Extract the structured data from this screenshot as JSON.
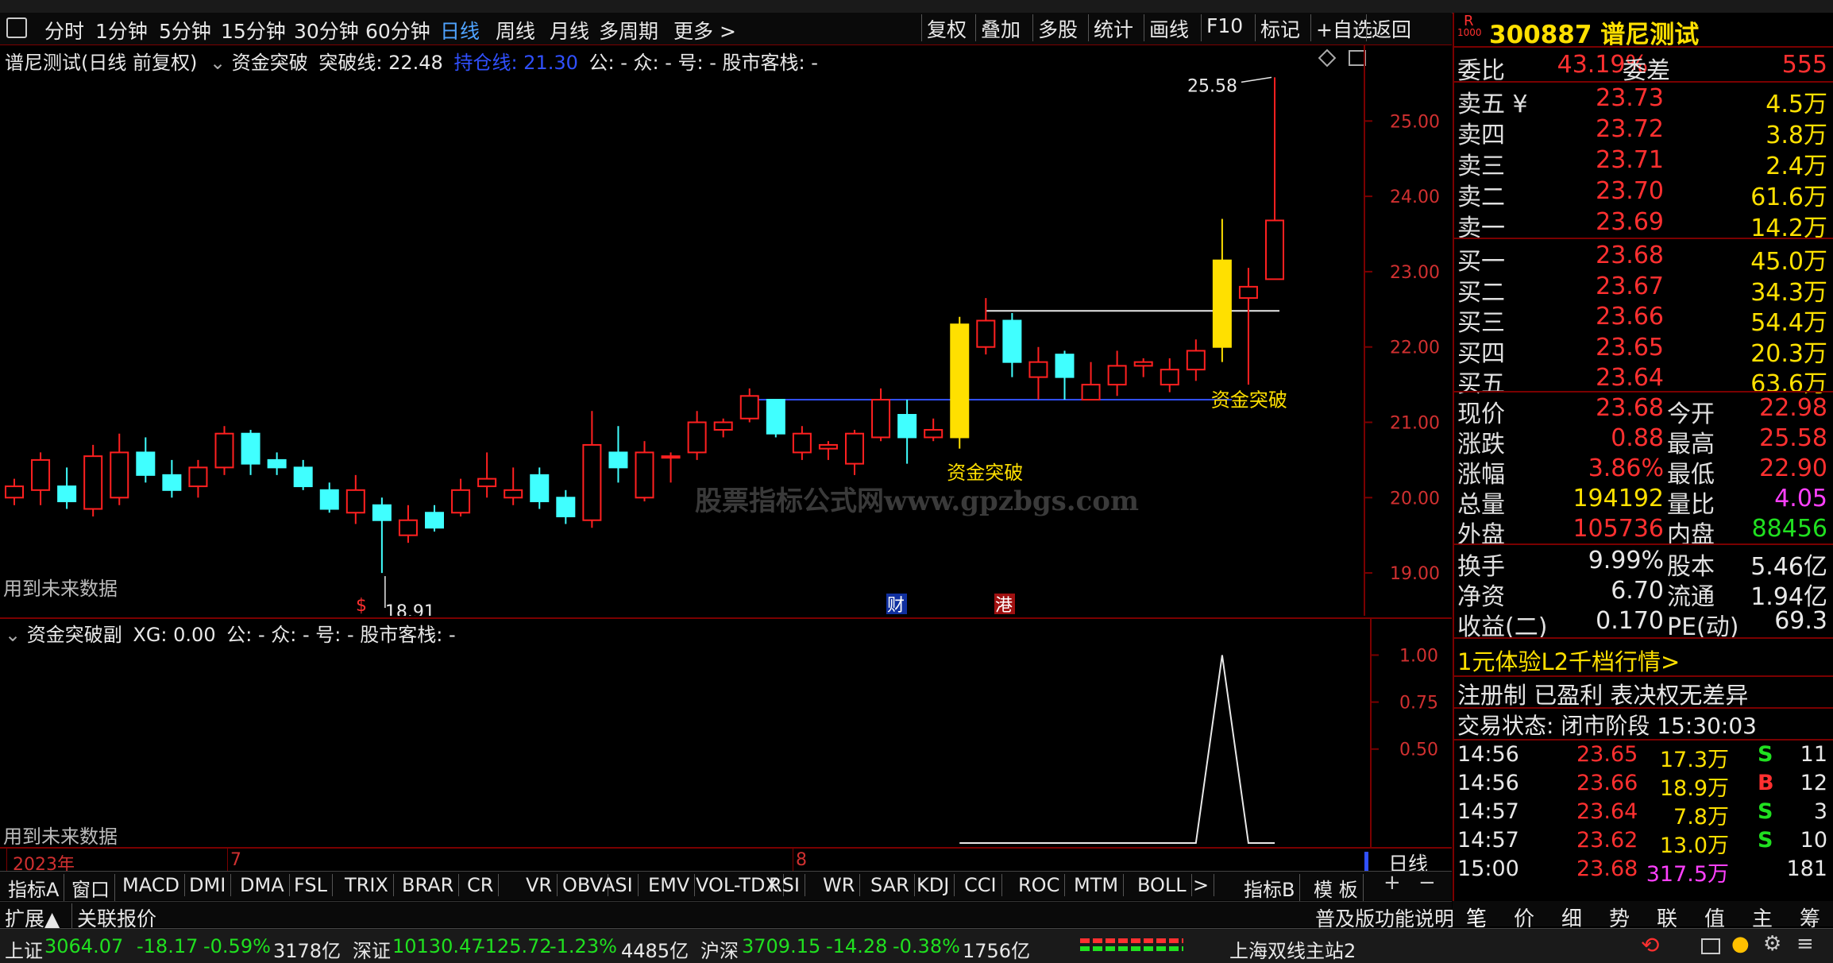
{
  "periods": [
    "分时",
    "1分钟",
    "5分钟",
    "15分钟",
    "30分钟",
    "60分钟",
    "日线",
    "周线",
    "月线",
    "多周期",
    "更多 >"
  ],
  "selected_period": "日线",
  "tools": [
    "复权",
    "叠加",
    "多股",
    "统计",
    "画线",
    "F10",
    "标记",
    "+自选",
    "返回"
  ],
  "main_header": {
    "title": "谱尼测试(日线 前复权)",
    "indicator": "资金突破",
    "line1": "突破线: 22.48",
    "line2": "持仓线: 21.30",
    "rest": "公: -  众: -  号: -  股市客栈: -"
  },
  "sub_header": {
    "indicator": "资金突破副",
    "xg": "XG: 0.00",
    "rest": "公: -  众: -  号: -  股市客栈: -"
  },
  "future_note": "用到未来数据",
  "watermark": "股票指标公式网www.gpzbgs.com",
  "annotations": {
    "high": "25.58",
    "low": "18.91",
    "signal1": "资金突破",
    "signal2": "资金突破",
    "mark_s": "$",
    "mark_cai": "财",
    "mark_gang": "港"
  },
  "axis_dates": {
    "year": "2023年",
    "m7": "7",
    "m8": "8"
  },
  "period_label": "日线",
  "zoom": {
    "plus": "+",
    "minus": "−"
  },
  "chart_data": {
    "type": "candlestick",
    "ylim": [
      18.6,
      25.9
    ],
    "yticks": [
      "25.00",
      "24.00",
      "23.00",
      "22.00",
      "21.00",
      "20.00",
      "19.00"
    ],
    "candles": [
      [
        20.0,
        20.15,
        19.9,
        20.25
      ],
      [
        20.1,
        20.5,
        19.9,
        20.6
      ],
      [
        20.15,
        19.95,
        19.85,
        20.4
      ],
      [
        19.85,
        20.55,
        19.75,
        20.7
      ],
      [
        20.0,
        20.6,
        19.9,
        20.85
      ],
      [
        20.6,
        20.3,
        20.2,
        20.8
      ],
      [
        20.3,
        20.1,
        20.0,
        20.5
      ],
      [
        20.15,
        20.4,
        20.0,
        20.5
      ],
      [
        20.4,
        20.85,
        20.3,
        20.95
      ],
      [
        20.85,
        20.45,
        20.3,
        20.9
      ],
      [
        20.5,
        20.4,
        20.3,
        20.6
      ],
      [
        20.4,
        20.15,
        20.1,
        20.5
      ],
      [
        20.1,
        19.85,
        19.8,
        20.2
      ],
      [
        19.8,
        20.1,
        19.65,
        20.3
      ],
      [
        19.9,
        19.7,
        19.0,
        20.0
      ],
      [
        19.5,
        19.7,
        19.4,
        19.9
      ],
      [
        19.8,
        19.6,
        19.55,
        19.9
      ],
      [
        19.8,
        20.1,
        19.75,
        20.25
      ],
      [
        20.15,
        20.25,
        20.0,
        20.6
      ],
      [
        20.0,
        20.1,
        19.9,
        20.4
      ],
      [
        20.3,
        19.95,
        19.85,
        20.4
      ],
      [
        20.0,
        19.75,
        19.65,
        20.1
      ],
      [
        19.7,
        20.7,
        19.6,
        21.15
      ],
      [
        20.6,
        20.4,
        20.2,
        20.95
      ],
      [
        20.0,
        20.6,
        19.95,
        20.75
      ],
      [
        20.55,
        20.55,
        20.2,
        20.6
      ],
      [
        20.6,
        21.0,
        20.5,
        21.15
      ],
      [
        20.9,
        21.0,
        20.8,
        21.05
      ],
      [
        21.05,
        21.35,
        21.0,
        21.45
      ],
      [
        21.3,
        20.85,
        20.8,
        21.3
      ],
      [
        20.6,
        20.85,
        20.5,
        20.95
      ],
      [
        20.65,
        20.7,
        20.5,
        20.75
      ],
      [
        20.45,
        20.85,
        20.3,
        20.9
      ],
      [
        20.8,
        21.3,
        20.75,
        21.45
      ],
      [
        21.1,
        20.8,
        20.45,
        21.3
      ],
      [
        20.8,
        20.9,
        20.75,
        21.05
      ],
      [
        20.8,
        22.3,
        20.65,
        22.4
      ],
      [
        22.0,
        22.35,
        21.9,
        22.65
      ],
      [
        22.35,
        21.8,
        21.6,
        22.45
      ],
      [
        21.6,
        21.8,
        21.3,
        22.0
      ],
      [
        21.9,
        21.6,
        21.3,
        21.95
      ],
      [
        21.3,
        21.5,
        21.3,
        21.8
      ],
      [
        21.5,
        21.75,
        21.35,
        21.95
      ],
      [
        21.75,
        21.8,
        21.6,
        21.85
      ],
      [
        21.5,
        21.7,
        21.4,
        21.85
      ],
      [
        21.7,
        21.95,
        21.55,
        22.1
      ],
      [
        22.0,
        23.15,
        21.8,
        23.7
      ],
      [
        22.65,
        22.8,
        21.5,
        23.05
      ],
      [
        22.9,
        23.68,
        22.9,
        25.58
      ]
    ],
    "breakout_line": 22.48,
    "hold_line": 21.3,
    "sub_ylim": [
      0,
      1.15
    ],
    "sub_yticks": [
      "1.00",
      "0.75",
      "0.50"
    ],
    "sub_values": [
      0,
      0,
      0,
      0,
      0,
      0,
      0,
      0,
      0,
      0,
      0,
      0,
      0,
      0,
      0,
      0,
      0,
      0,
      0,
      0,
      0,
      0,
      0,
      0,
      0,
      0,
      0,
      0,
      0,
      0,
      0,
      0,
      0,
      0,
      0,
      0,
      0,
      0,
      0,
      0,
      0,
      0,
      0,
      0,
      0,
      0,
      1,
      0,
      0
    ]
  },
  "quote": {
    "code": "300887",
    "name": "谱尼测试",
    "rflag": "R",
    "rsub": "1000",
    "weibi_lbl": "委比",
    "weibi": "43.19%",
    "weicha_lbl": "委差",
    "weicha": "555",
    "sells": [
      {
        "l": "卖五 ¥",
        "p": "23.73",
        "v": "4.5万"
      },
      {
        "l": "卖四",
        "p": "23.72",
        "v": "3.8万"
      },
      {
        "l": "卖三",
        "p": "23.71",
        "v": "2.4万"
      },
      {
        "l": "卖二",
        "p": "23.70",
        "v": "61.6万"
      },
      {
        "l": "卖一",
        "p": "23.69",
        "v": "14.2万"
      }
    ],
    "buys": [
      {
        "l": "买一",
        "p": "23.68",
        "v": "45.0万"
      },
      {
        "l": "买二",
        "p": "23.67",
        "v": "34.3万"
      },
      {
        "l": "买三",
        "p": "23.66",
        "v": "54.4万"
      },
      {
        "l": "买四",
        "p": "23.65",
        "v": "20.3万"
      },
      {
        "l": "买五",
        "p": "23.64",
        "v": "63.6万"
      }
    ],
    "stats": [
      {
        "l1": "现价",
        "v1": "23.68",
        "c1": "red",
        "l2": "今开",
        "v2": "22.98",
        "c2": "red"
      },
      {
        "l1": "涨跌",
        "v1": "0.88",
        "c1": "red",
        "l2": "最高",
        "v2": "25.58",
        "c2": "red"
      },
      {
        "l1": "涨幅",
        "v1": "3.86%",
        "c1": "red",
        "l2": "最低",
        "v2": "22.90",
        "c2": "red"
      },
      {
        "l1": "总量",
        "v1": "194192",
        "c1": "yel",
        "l2": "量比",
        "v2": "4.05",
        "c2": "mag"
      },
      {
        "l1": "外盘",
        "v1": "105736",
        "c1": "red",
        "l2": "内盘",
        "v2": "88456",
        "c2": "green"
      }
    ],
    "stats2": [
      {
        "l1": "换手",
        "v1": "9.99%",
        "l2": "股本",
        "v2": "5.46亿"
      },
      {
        "l1": "净资",
        "v1": "6.70",
        "l2": "流通",
        "v2": "1.94亿"
      },
      {
        "l1": "收益(二)",
        "v1": "0.170",
        "l2": "PE(动)",
        "v2": "69.3"
      }
    ],
    "promo": "1元体验L2千档行情>",
    "notice": "注册制 已盈利 表决权无差异",
    "trade_status": "交易状态: 闭市阶段 15:30:03",
    "ticks": [
      {
        "t": "14:56",
        "p": "23.65",
        "v": "17.3万",
        "s": "S",
        "n": "11"
      },
      {
        "t": "14:56",
        "p": "23.66",
        "v": "18.9万",
        "s": "B",
        "n": "12"
      },
      {
        "t": "14:57",
        "p": "23.64",
        "v": "7.8万",
        "s": "S",
        "n": "3"
      },
      {
        "t": "14:57",
        "p": "23.62",
        "v": "13.0万",
        "s": "S",
        "n": "10"
      },
      {
        "t": "15:00",
        "p": "23.68",
        "v": "317.5万",
        "s": "",
        "n": "181"
      }
    ]
  },
  "indicators": [
    "指标A",
    "窗口",
    "MACD",
    "DMI",
    "DMA",
    "FSL",
    "TRIX",
    "BRAR",
    "CR",
    "VR",
    "OBV",
    "ASI",
    "EMV",
    "VOL-TDX",
    "RSI",
    "WR",
    "SAR",
    "KDJ",
    "CCI",
    "ROC",
    "MTM",
    "BOLL",
    ">"
  ],
  "ind_right": [
    "指标B",
    "模 板"
  ],
  "ext": [
    "扩展▲",
    "关联报价"
  ],
  "ext_right": "普及版功能说明",
  "qtabs": [
    "笔",
    "价",
    "细",
    "势",
    "联",
    "值",
    "主",
    "筹"
  ],
  "status": {
    "sh_lbl": "上证",
    "sh": "3064.07",
    "sh_chg": "-18.17",
    "sh_pct": "-0.59%",
    "sh_amt": "3178亿",
    "sz_lbl": "深证",
    "sz": "10130.47",
    "sz_chg": "-125.72",
    "sz_pct": "-1.23%",
    "sz_amt": "4485亿",
    "hs_lbl": "沪深",
    "hs": "3709.15",
    "hs_chg": "-14.28",
    "hs_pct": "-0.38%",
    "hs_amt": "1756亿",
    "server": "上海双线主站2"
  }
}
